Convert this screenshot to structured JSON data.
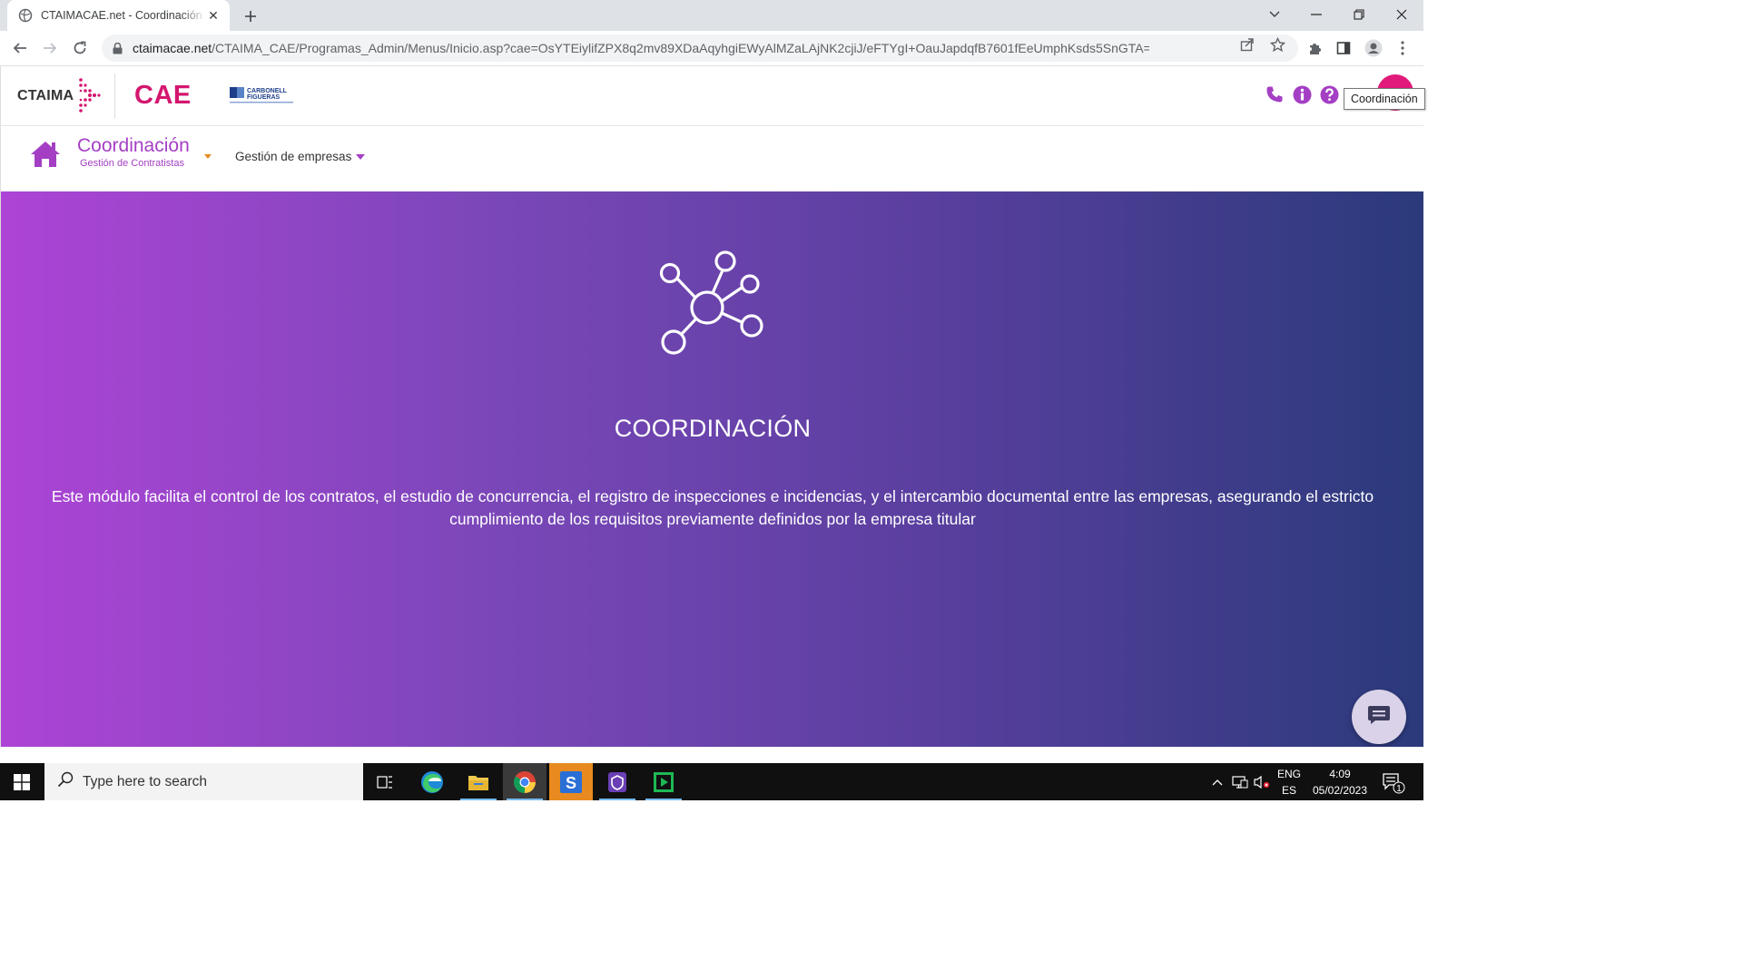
{
  "browser": {
    "tab_title": "CTAIMACAE.net - Coordinación de Contratistas",
    "close_tab_glyph": "✕",
    "new_tab_glyph": "+",
    "url_host": "ctaimacae.net",
    "url_path": "/CTAIMA_CAE/Programas_Admin/Menus/Inicio.asp?cae=OsYTEiylifZPX8q2mv89XDaAqyhgiEWyAlMZaLAjNK2cjiJ/eFTYgI+OauJapdqfB7601fEeUmphKsds5SnGTA=="
  },
  "header": {
    "brand": "CTAIMA",
    "product": "CAE",
    "client_logo_line1": "CARBONELL",
    "client_logo_line2": "FIGUERAS",
    "tooltip": "Coordinación",
    "accent_color": "#d4166f"
  },
  "module_nav": {
    "title": "Coordinación",
    "subtitle": "Gestión de Contratistas",
    "menu_item": "Gestión de empresas"
  },
  "hero": {
    "title": "COORDINACIÓN",
    "description": "Este módulo facilita el control de los contratos, el estudio de concurrencia, el registro de inspecciones e incidencias, y el intercambio documental entre las empresas, asegurando el estricto cumplimiento de los requisitos previamente definidos por la empresa titular",
    "icon": "network-hub-icon",
    "gradient": [
      "#ad44d6",
      "#2b3a7b"
    ]
  },
  "taskbar": {
    "search_placeholder": "Type here to search",
    "lang_top": "ENG",
    "lang_bottom": "ES",
    "time": "4:09",
    "date": "05/02/2023",
    "notif_count": "1"
  }
}
